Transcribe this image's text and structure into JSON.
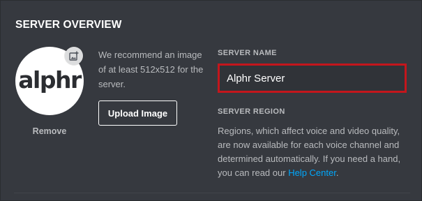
{
  "section_title": "SERVER OVERVIEW",
  "avatar": {
    "logo_text": "alphr",
    "add_image_icon": "add-image-icon",
    "remove_label": "Remove"
  },
  "upload": {
    "recommendation": "We recommend an image of at least 512x512 for the server.",
    "button_label": "Upload Image"
  },
  "server_name": {
    "label": "SERVER NAME",
    "value": "Alphr Server",
    "highlight_color": "#c4161c"
  },
  "server_region": {
    "label": "SERVER REGION",
    "description": "Regions, which affect voice and video quality, are now available for each voice channel and determined automatically. If you need a hand, you can read our ",
    "link_text": "Help Center",
    "suffix": "."
  },
  "colors": {
    "background": "#36393f",
    "link": "#00a8fc",
    "heading": "#ffffff",
    "muted": "#b9bbbe"
  }
}
